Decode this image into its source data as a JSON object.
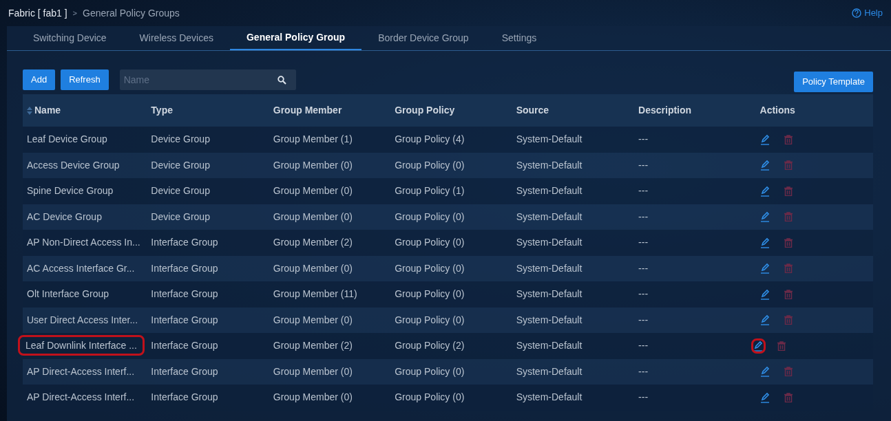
{
  "breadcrumb": {
    "root": "Fabric [ fab1 ]",
    "separator": ">",
    "current": "General Policy Groups"
  },
  "help": {
    "label": "Help"
  },
  "tabs": [
    {
      "label": "Switching Device",
      "selected": false
    },
    {
      "label": "Wireless Devices",
      "selected": false
    },
    {
      "label": "General Policy Group",
      "selected": true
    },
    {
      "label": "Border Device Group",
      "selected": false
    },
    {
      "label": "Settings",
      "selected": false
    }
  ],
  "toolbar": {
    "buttons": [
      "Add",
      "Refresh"
    ],
    "search": {
      "placeholder": "Name"
    },
    "right_button": "Policy Template"
  },
  "table": {
    "columns": [
      {
        "label": "Name",
        "sortable": true
      },
      {
        "label": "Type",
        "sortable": false
      },
      {
        "label": "Group Member",
        "sortable": false
      },
      {
        "label": "Group Policy",
        "sortable": false
      },
      {
        "label": "Source",
        "sortable": false
      },
      {
        "label": "Description",
        "sortable": false
      },
      {
        "label": "Actions",
        "sortable": false
      }
    ],
    "rows": [
      {
        "name": "Leaf Device Group",
        "type": "Device Group",
        "member": "Group Member (1)",
        "policy": "Group Policy (4)",
        "source": "System-Default",
        "description": "---",
        "highlighted": false
      },
      {
        "name": "Access Device Group",
        "type": "Device Group",
        "member": "Group Member (0)",
        "policy": "Group Policy (0)",
        "source": "System-Default",
        "description": "---",
        "highlighted": false
      },
      {
        "name": "Spine Device Group",
        "type": "Device Group",
        "member": "Group Member (0)",
        "policy": "Group Policy (1)",
        "source": "System-Default",
        "description": "---",
        "highlighted": false
      },
      {
        "name": "AC Device Group",
        "type": "Device Group",
        "member": "Group Member (0)",
        "policy": "Group Policy (0)",
        "source": "System-Default",
        "description": "---",
        "highlighted": false
      },
      {
        "name": "AP Non-Direct Access In...",
        "type": "Interface Group",
        "member": "Group Member (2)",
        "policy": "Group Policy (0)",
        "source": "System-Default",
        "description": "---",
        "highlighted": false
      },
      {
        "name": "AC Access Interface Gr...",
        "type": "Interface Group",
        "member": "Group Member (0)",
        "policy": "Group Policy (0)",
        "source": "System-Default",
        "description": "---",
        "highlighted": false
      },
      {
        "name": "Olt Interface Group",
        "type": "Interface Group",
        "member": "Group Member (11)",
        "policy": "Group Policy (0)",
        "source": "System-Default",
        "description": "---",
        "highlighted": false
      },
      {
        "name": "User Direct Access Inter...",
        "type": "Interface Group",
        "member": "Group Member (0)",
        "policy": "Group Policy (0)",
        "source": "System-Default",
        "description": "---",
        "highlighted": false
      },
      {
        "name": "Leaf Downlink Interface ...",
        "type": "Interface Group",
        "member": "Group Member (2)",
        "policy": "Group Policy (2)",
        "source": "System-Default",
        "description": "---",
        "highlighted": true
      },
      {
        "name": "AP Direct-Access Interf...",
        "type": "Interface Group",
        "member": "Group Member (0)",
        "policy": "Group Policy (0)",
        "source": "System-Default",
        "description": "---",
        "highlighted": false
      },
      {
        "name": "AP Direct-Access Interf...",
        "type": "Interface Group",
        "member": "Group Member (0)",
        "policy": "Group Policy (0)",
        "source": "System-Default",
        "description": "---",
        "highlighted": false
      }
    ]
  }
}
